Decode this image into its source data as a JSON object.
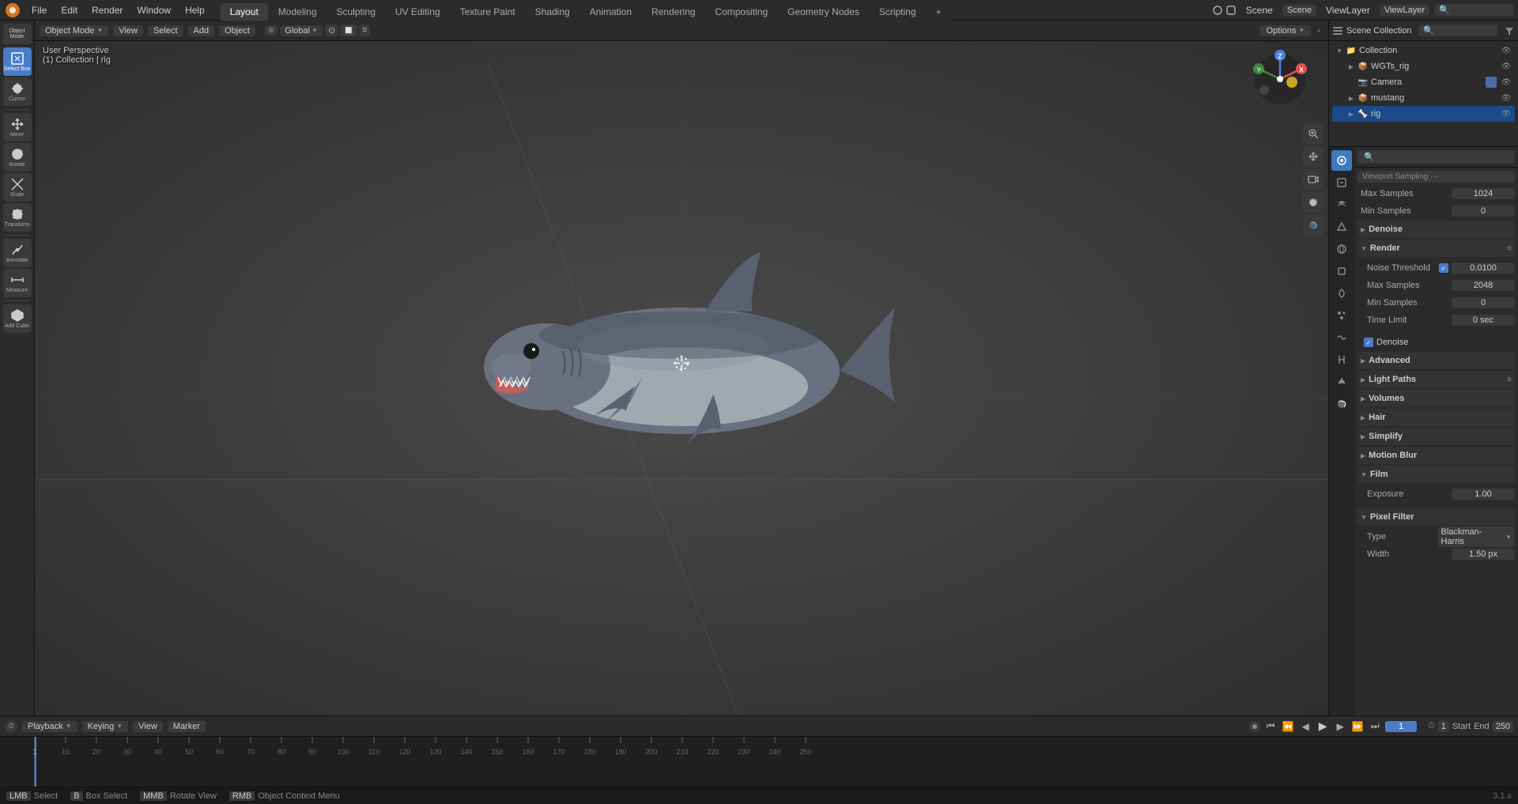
{
  "topbar": {
    "menus": [
      "File",
      "Edit",
      "Render",
      "Window",
      "Help"
    ],
    "workspaces": [
      "Layout",
      "Modeling",
      "Sculpting",
      "UV Editing",
      "Texture Paint",
      "Shading",
      "Animation",
      "Rendering",
      "Compositing",
      "Geometry Nodes",
      "Scripting"
    ],
    "active_workspace": "Layout",
    "scene_label": "Scene",
    "view_layer_label": "ViewLayer"
  },
  "viewport": {
    "mode": "Object Mode",
    "view_label": "View",
    "select_label": "Select",
    "add_label": "Add",
    "object_label": "Object",
    "perspective": "User Perspective",
    "collection_info": "(1) Collection | rig",
    "transform": "Global",
    "options_label": "Options"
  },
  "left_toolbar": {
    "tools": [
      {
        "name": "select-box",
        "label": "Select Box",
        "active": true
      },
      {
        "name": "cursor",
        "label": "Cursor",
        "active": false
      },
      {
        "name": "move",
        "label": "Move",
        "active": false
      },
      {
        "name": "rotate",
        "label": "Rotate",
        "active": false
      },
      {
        "name": "scale",
        "label": "Scale",
        "active": false
      },
      {
        "name": "transform",
        "label": "Transform",
        "active": false
      },
      {
        "name": "annotate",
        "label": "Annotate",
        "active": false
      },
      {
        "name": "measure",
        "label": "Measure",
        "active": false
      },
      {
        "name": "add-cube",
        "label": "Add Cube",
        "active": false
      }
    ]
  },
  "outliner": {
    "title": "Scene Collection",
    "items": [
      {
        "name": "collection",
        "label": "Collection",
        "level": 0,
        "expanded": true,
        "icon": "📁"
      },
      {
        "name": "wgts-rig",
        "label": "WGTs_rig",
        "level": 1,
        "expanded": false,
        "icon": "📦"
      },
      {
        "name": "camera",
        "label": "Camera",
        "level": 1,
        "expanded": false,
        "icon": "📷"
      },
      {
        "name": "mustang",
        "label": "mustang",
        "level": 1,
        "expanded": false,
        "icon": "📦"
      },
      {
        "name": "rig",
        "label": "rig",
        "level": 1,
        "expanded": false,
        "icon": "🦴",
        "selected": true
      }
    ]
  },
  "properties": {
    "tabs": [
      "render",
      "output",
      "view-layer",
      "scene",
      "world",
      "object",
      "modifier",
      "particle",
      "physics",
      "constraints",
      "object-data",
      "material",
      "texture"
    ],
    "active_tab": "render",
    "sections": {
      "sampling": {
        "title": "Sampling",
        "max_samples_viewport": {
          "label": "Max Samples",
          "value": "1024"
        },
        "min_samples_viewport": {
          "label": "Min Samples",
          "value": "0"
        }
      },
      "denoise": {
        "title": "Denoise",
        "enabled": true
      },
      "render": {
        "title": "Render",
        "noise_threshold": {
          "label": "Noise Threshold",
          "value": "0.0100",
          "enabled": true
        },
        "max_samples": {
          "label": "Max Samples",
          "value": "2048"
        },
        "min_samples": {
          "label": "Min Samples",
          "value": "0"
        },
        "time_limit": {
          "label": "Time Limit",
          "value": "0 sec"
        }
      },
      "denoise2": {
        "title": "Denoise",
        "enabled": true
      },
      "advanced": {
        "title": "Advanced"
      },
      "light_paths": {
        "title": "Light Paths"
      },
      "volumes": {
        "title": "Volumes"
      },
      "hair": {
        "title": "Hair"
      },
      "simplify": {
        "title": "Simplify"
      },
      "motion_blur": {
        "title": "Motion Blur"
      },
      "film": {
        "title": "Film",
        "exposure": {
          "label": "Exposure",
          "value": "1.00"
        }
      },
      "pixel_filter": {
        "title": "Pixel Filter",
        "type": {
          "label": "Type",
          "value": "Blackman-Harris"
        },
        "width": {
          "label": "Width",
          "value": "1.50 px"
        }
      }
    }
  },
  "timeline": {
    "playback_label": "Playback",
    "keying_label": "Keying",
    "view_label": "View",
    "marker_label": "Marker",
    "current_frame": "1",
    "start_label": "Start",
    "start_value": "1",
    "end_label": "End",
    "end_value": "250",
    "ruler_marks": [
      "1",
      "10",
      "20",
      "30",
      "40",
      "50",
      "60",
      "70",
      "80",
      "90",
      "100",
      "110",
      "120",
      "130",
      "140",
      "150",
      "160",
      "170",
      "180",
      "190",
      "200",
      "210",
      "220",
      "230",
      "240",
      "250"
    ]
  },
  "statusbar": {
    "select_label": "Select",
    "select_key": "LMB",
    "box_select_label": "Box Select",
    "box_select_key": "B",
    "rotate_view_label": "Rotate View",
    "rotate_view_key": "MMB",
    "context_menu_label": "Object Context Menu",
    "context_menu_key": "RMB"
  },
  "colors": {
    "active_blue": "#4a7bc8",
    "bg_dark": "#1a1a1a",
    "bg_mid": "#2b2b2b",
    "bg_light": "#3a3a3a",
    "text_normal": "#cccccc",
    "text_dim": "#888888",
    "accent": "#4a7bc8",
    "gizmo_x": "#e05050",
    "gizmo_y": "#50c050",
    "gizmo_z": "#5080e0"
  }
}
